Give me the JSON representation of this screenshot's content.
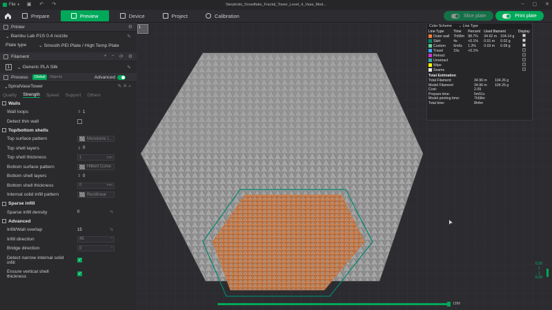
{
  "titlebar": {
    "menu_label": "File",
    "title": "Sierpinski_Snowflake_Fractal_Tower_Level_4_Vase_Mod..."
  },
  "tabs": [
    {
      "label": "Prepare",
      "icon": "cube-icon"
    },
    {
      "label": "Preview",
      "icon": "preview-icon"
    },
    {
      "label": "Device",
      "icon": "device-icon"
    },
    {
      "label": "Project",
      "icon": "project-icon"
    },
    {
      "label": "Calibration",
      "icon": "calibration-icon"
    }
  ],
  "actions": {
    "slice_label": "Slice plate",
    "print_label": "Print plate"
  },
  "sidebar": {
    "printer_header": "Printer",
    "printer_name": "Bambu Lab P1S 0.4 nozzle",
    "plate_type_label": "Plate type",
    "plate_type_value": "Smooth PEI Plate / High Temp Plate",
    "filament_header": "Filament",
    "filament_index": "1",
    "filament_name": "Generic PLA Silk",
    "process_header": "Process",
    "global_label": "Global",
    "objects_label": "Objects",
    "advanced_label": "Advanced",
    "process_name": "SpiralVaseTower",
    "subtabs": [
      "Quality",
      "Strength",
      "Speed",
      "Support",
      "Others"
    ],
    "walls_group": "Walls",
    "wall_loops_label": "Wall loops",
    "wall_loops_value": "1",
    "detect_thin_wall_label": "Detect thin wall",
    "topbottom_group": "Top/bottom shells",
    "top_surface_pattern_label": "Top surface pattern",
    "top_surface_pattern_value": "Monotonic l...",
    "top_shell_layers_label": "Top shell layers",
    "top_shell_layers_value": "0",
    "top_shell_thickness_label": "Top shell thickness",
    "top_shell_thickness_value": "1",
    "bottom_surface_pattern_label": "Bottom surface pattern",
    "bottom_surface_pattern_value": "Hilbert Curve",
    "bottom_shell_layers_label": "Bottom shell layers",
    "bottom_shell_layers_value": "0",
    "bottom_shell_thickness_label": "Bottom shell thickness",
    "bottom_shell_thickness_value": "0",
    "internal_solid_label": "Internal solid infill pattern",
    "internal_solid_value": "Rectilinear",
    "sparse_group": "Sparse infill",
    "sparse_density_label": "Sparse infill density",
    "sparse_density_value": "0",
    "advanced_group": "Advanced",
    "infill_overlap_label": "Infill/Wall overlap",
    "infill_overlap_value": "15",
    "infill_direction_label": "Infill direction",
    "infill_direction_value": "45",
    "bridge_direction_label": "Bridge direction",
    "bridge_direction_value": "0",
    "detect_narrow_label_1": "Detect narrow internal solid",
    "detect_narrow_label_2": "infill",
    "ensure_vertical_label_1": "Ensure vertical shell",
    "ensure_vertical_label_2": "thickness",
    "unit_mm": "mm",
    "unit_pct": "%",
    "unit_deg": "°"
  },
  "plate_thumb_label": "1",
  "legend": {
    "color_scheme_label": "Color Scheme",
    "scheme_value": "Line Type",
    "headers": [
      "Line Type",
      "Time",
      "Percent",
      "Used filament",
      "",
      "Display"
    ],
    "rows": [
      {
        "name": "Outer wall",
        "color": "#ff7d38",
        "time": "7h58m",
        "percent": "98.7%",
        "used_m": "34.92 m",
        "used_g": "104.14 g",
        "display": true
      },
      {
        "name": "Skirt",
        "color": "#00876e",
        "time": "4s",
        "percent": "<0.1%",
        "used_m": "0.01 m",
        "used_g": "0.02 g",
        "display": true
      },
      {
        "name": "Custom",
        "color": "#5ed194",
        "time": "6m6s",
        "percent": "1.3%",
        "used_m": "0.03 m",
        "used_g": "0.09 g",
        "display": true
      },
      {
        "name": "Travel",
        "color": "#38a8ff",
        "time": "15s",
        "percent": "<0.1%",
        "used_m": "",
        "used_g": "",
        "display": false
      },
      {
        "name": "Retract",
        "color": "#cc33cc",
        "time": "",
        "percent": "",
        "used_m": "",
        "used_g": "",
        "display": false
      },
      {
        "name": "Unretract",
        "color": "#38a8a8",
        "time": "",
        "percent": "",
        "used_m": "",
        "used_g": "",
        "display": false
      },
      {
        "name": "Wipe",
        "color": "#ffff00",
        "time": "",
        "percent": "",
        "used_m": "",
        "used_g": "",
        "display": false
      },
      {
        "name": "Seams",
        "color": "#e6e6e6",
        "time": "",
        "percent": "",
        "used_m": "",
        "used_g": "",
        "display": false
      }
    ],
    "estimation_header": "Total Estimation",
    "estimation": [
      {
        "k": "Total Filament:",
        "v1": "34.96 m",
        "v2": "104.26 g"
      },
      {
        "k": "Model Filament:",
        "v1": "34.96 m",
        "v2": "104.26 g"
      },
      {
        "k": "Cost:",
        "v1": "2.09",
        "v2": ""
      },
      {
        "k": "Prepare time:",
        "v1": "5m51s",
        "v2": ""
      },
      {
        "k": "Model printing time:",
        "v1": "7h58m",
        "v2": ""
      },
      {
        "k": "Total time:",
        "v1": "8h4m",
        "v2": ""
      }
    ]
  },
  "layer_slider": {
    "value_label": "1396"
  },
  "vertical_slider": {
    "top_label": "0.20",
    "top_index": "1",
    "bottom_label": "0.20",
    "bottom_index": "1"
  },
  "colors": {
    "accent": "#00a85a",
    "outer_wall": "#ff7d38",
    "skirt": "#00876e",
    "model_gray": "#8c8c8c"
  }
}
